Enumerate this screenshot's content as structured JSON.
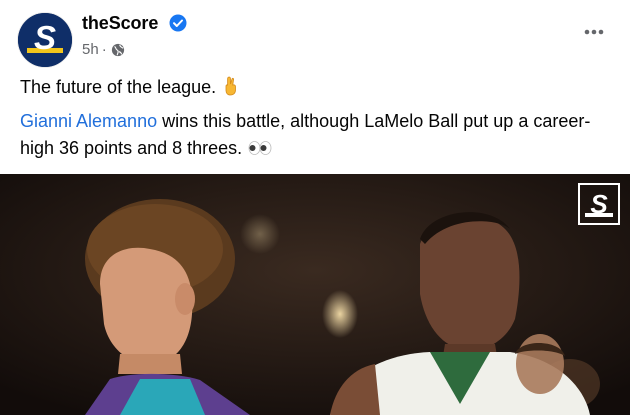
{
  "post": {
    "author": "theScore",
    "timestamp": "5h",
    "separator": "·",
    "verified": true,
    "avatar_icon": "thescore-logo-icon",
    "audience_icon": "globe-icon",
    "more_icon": "more-options-icon",
    "headline": "The future of the league.",
    "headline_emoji": "crossed-fingers-emoji",
    "mention": "Gianni Alemanno",
    "body": " wins this battle, although LaMelo Ball put up a career-high 36 points and 8 threes.",
    "body_emoji": "eyes-emoji",
    "media_watermark": "thescore-watermark-icon"
  },
  "colors": {
    "brand_navy": "#0f2e68",
    "brand_yellow": "#f2c51b",
    "link": "#216fdb",
    "meta_gray": "#65676b",
    "verified_blue": "#1877f2"
  }
}
